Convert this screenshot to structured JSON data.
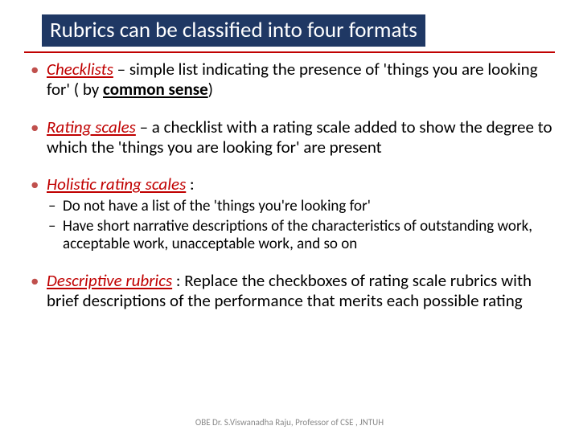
{
  "title": "Rubrics can be classified into four formats",
  "items": [
    {
      "term": "Checklists",
      "rest": " – simple list indicating the presence of 'things you are looking for' ( by ",
      "cs": "common sense",
      "tail": ")"
    },
    {
      "term": "Rating scales",
      "rest": " – a checklist with a rating scale added to show the degree to which the 'things you are looking for' are present"
    },
    {
      "term": "Holistic rating scales",
      "rest": " :",
      "sub": [
        "Do not have a list of the 'things you're looking for'",
        "Have short narrative descriptions of the characteristics of outstanding work, acceptable work, unacceptable work, and so on"
      ]
    },
    {
      "term": "Descriptive rubrics",
      "rest": " : Replace the checkboxes of rating scale rubrics with brief descriptions of the performance that merits each possible rating"
    }
  ],
  "footer": "OBE    Dr. S.Viswanadha Raju, Professor of CSE , JNTUH"
}
